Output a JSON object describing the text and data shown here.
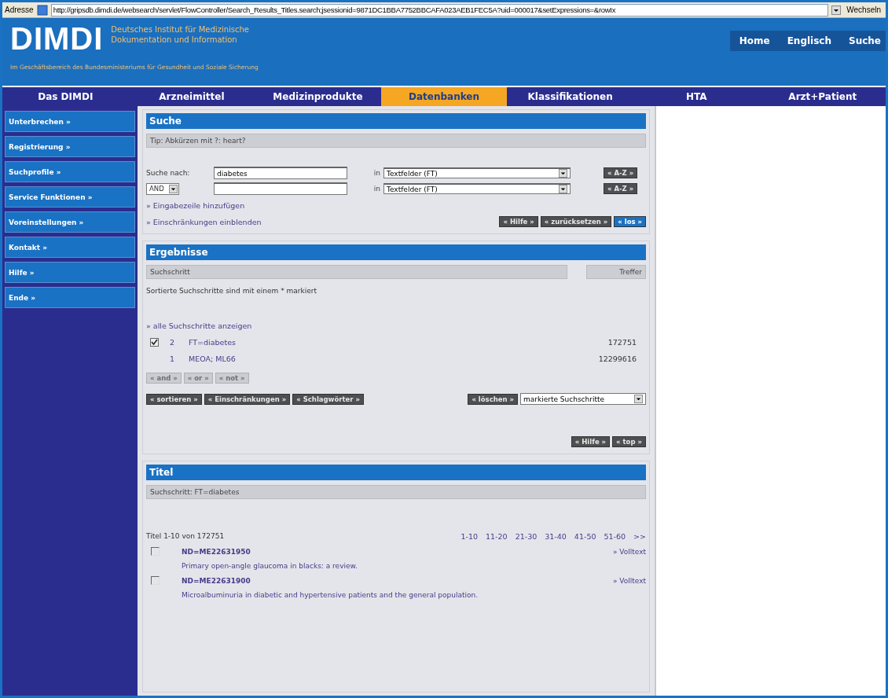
{
  "address_bar": {
    "label": "Adresse",
    "url": "http://gripsdb.dimdi.de/websearch/servlet/FlowController/Search_Results_Titles.search;jsessionid=9871DC1BBA7752BBCAFA023AEB1FEC5A?uid=000017&setExpressions=&rowIx",
    "go": "Wechseln"
  },
  "header": {
    "logo": "DIMDI",
    "org_line_1": "Deutsches Institut für Medizinische",
    "org_line_2": "Dokumentation und Information",
    "tagline": "Im Geschäftsbereich des Bundesministeriums für Gesundheit und Soziale Sicherung",
    "links": [
      "Home",
      "Englisch",
      "Suche"
    ]
  },
  "nav": [
    {
      "label": "Das DIMDI",
      "selected": false
    },
    {
      "label": "Arzneimittel",
      "selected": false
    },
    {
      "label": "Medizinprodukte",
      "selected": false
    },
    {
      "label": "Datenbanken",
      "selected": true
    },
    {
      "label": "Klassifikationen",
      "selected": false
    },
    {
      "label": "HTA",
      "selected": false
    },
    {
      "label": "Arzt+Patient",
      "selected": false
    }
  ],
  "sidebar": [
    "Unterbrechen »",
    "Registrierung »",
    "Suchprofile »",
    "Service Funktionen »",
    "Voreinstellungen »",
    "Kontakt »",
    "Hilfe »",
    "Ende »"
  ],
  "search": {
    "title": "Suche",
    "tip": "Tip: Abkürzen mit ?: heart?",
    "rows": [
      {
        "kind": "label",
        "label": "Suche nach:",
        "value": "diabetes",
        "in": "in",
        "field": "Textfelder (FT)",
        "az": "« A-Z »"
      },
      {
        "kind": "operator",
        "operator": "AND",
        "value": "",
        "in": "in",
        "field": "Textfelder (FT)",
        "az": "« A-Z »"
      }
    ],
    "links": [
      "» Eingabezeile hinzufügen",
      "» Einschränkungen einblenden"
    ],
    "buttons": [
      {
        "label": "« Hilfe »",
        "kind": "normal"
      },
      {
        "label": "« zurücksetzen »",
        "kind": "normal"
      },
      {
        "label": "« los »",
        "kind": "primary"
      }
    ]
  },
  "results": {
    "title": "Ergebnisse",
    "col_step": "Suchschritt",
    "col_hits": "Treffer",
    "note": "Sortierte Suchschritte sind mit einem * markiert",
    "show_all": "» alle Suchschritte anzeigen",
    "steps": [
      {
        "checked": true,
        "number": "2",
        "query": "FT=diabetes",
        "hits": "172751"
      },
      {
        "checked": false,
        "number": "1",
        "query": "MEOA; ML66",
        "hits": "12299616"
      }
    ],
    "operators": [
      {
        "label": "« and »",
        "disabled": true
      },
      {
        "label": "« or »",
        "disabled": true
      },
      {
        "label": "« not »",
        "disabled": true
      }
    ],
    "actions": [
      "« sortieren »",
      "« Einschränkungen »",
      "« Schlagwörter »"
    ],
    "delete": "« löschen »",
    "delete_target": "markierte Suchschritte",
    "footer_buttons": [
      "« Hilfe »",
      "« top »"
    ]
  },
  "titles": {
    "title": "Titel",
    "step": "Suchschritt:  FT=diabetes",
    "count": "Titel 1-10 von 172751",
    "pages": [
      "1-10",
      "11-20",
      "21-30",
      "31-40",
      "41-50",
      "51-60",
      ">>"
    ],
    "items": [
      {
        "checked": false,
        "id": "ND=ME22631950",
        "fulltext": "» Volltext",
        "title": "Primary open-angle glaucoma in blacks: a review."
      },
      {
        "checked": false,
        "id": "ND=ME22631900",
        "fulltext": "» Volltext",
        "title": "Microalbuminuria in diabetic and hypertensive patients and the general population."
      }
    ]
  }
}
